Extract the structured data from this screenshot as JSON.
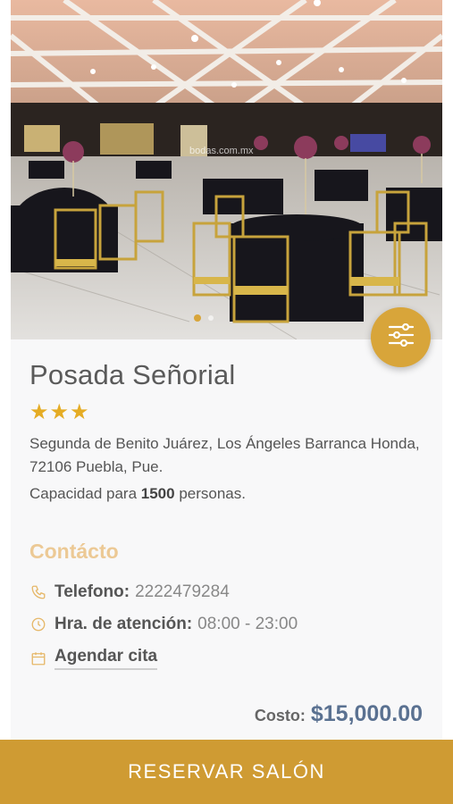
{
  "venue": {
    "name": "Posada Señorial",
    "rating": 3,
    "address": "Segunda de Benito Juárez, Los Ángeles Barranca Honda, 72106 Puebla, Pue.",
    "capacity_prefix": "Capacidad para",
    "capacity_value": "1500",
    "capacity_suffix": "personas."
  },
  "photo": {
    "watermark": "bodas.com.mx",
    "carousel_dots": 2,
    "active_dot": 0
  },
  "contact": {
    "title": "Contácto",
    "phone_label": "Telefono:",
    "phone_value": "2222479284",
    "hours_label": "Hra. de atención:",
    "hours_value": "08:00 - 23:00",
    "appointment_label": "Agendar cita"
  },
  "pricing": {
    "label": "Costo:",
    "value": "$15,000.00"
  },
  "actions": {
    "reserve_label": "RESERVAR SALÓN"
  },
  "icons": {
    "fab": "filter-sliders-icon",
    "phone": "phone-icon",
    "hours": "clock-icon",
    "appointment": "calendar-icon",
    "star": "star-icon"
  },
  "colors": {
    "accent": "#cf9b33",
    "fab": "#d8a53a",
    "star": "#e5ac24",
    "contact_title": "#ecc995",
    "price": "#5a7191"
  }
}
